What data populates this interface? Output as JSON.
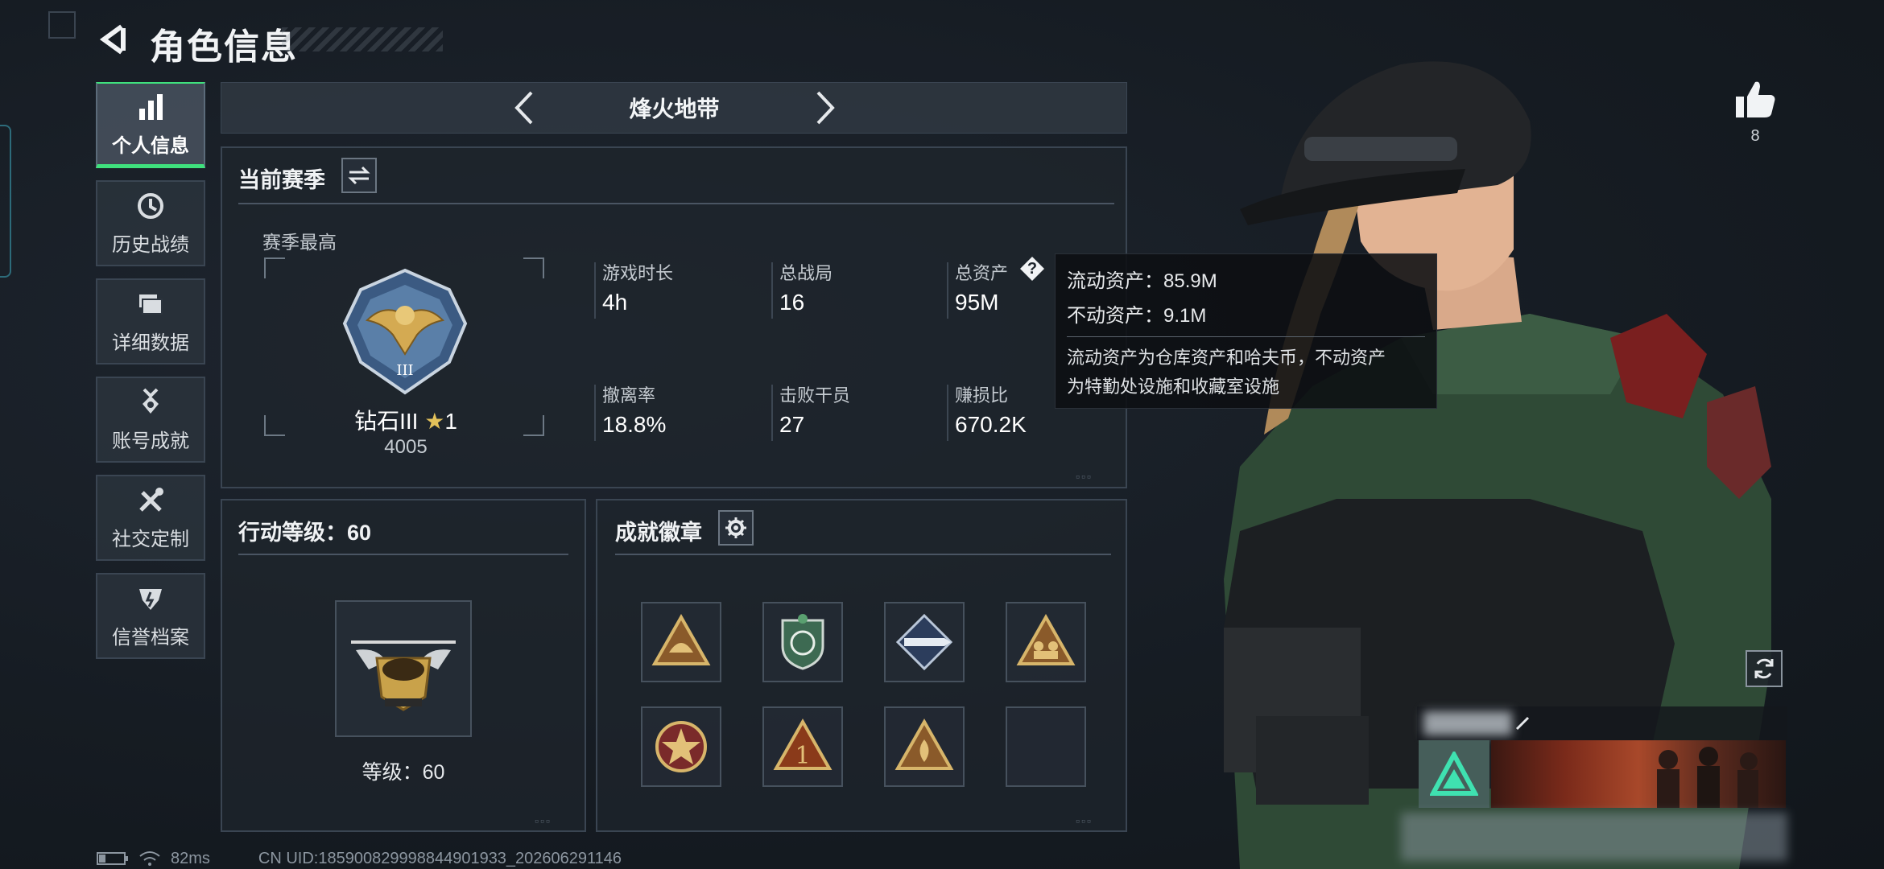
{
  "header": {
    "title": "角色信息"
  },
  "sidebar": {
    "items": [
      {
        "label": "个人信息",
        "icon": "bar-chart-icon",
        "active": true
      },
      {
        "label": "历史战绩",
        "icon": "clock-history-icon",
        "active": false
      },
      {
        "label": "详细数据",
        "icon": "folder-icon",
        "active": false
      },
      {
        "label": "账号成就",
        "icon": "medal-icon",
        "active": false
      },
      {
        "label": "社交定制",
        "icon": "tools-icon",
        "active": false
      },
      {
        "label": "信誉档案",
        "icon": "shield-credit-icon",
        "active": false
      }
    ]
  },
  "mode": {
    "name": "烽火地带"
  },
  "season": {
    "title": "当前赛季",
    "best_label": "赛季最高",
    "rank_name": "钻石III",
    "rank_stars": "1",
    "rank_points": "4005",
    "stats": [
      {
        "label": "游戏时长",
        "value": "4h"
      },
      {
        "label": "总战局",
        "value": "16"
      },
      {
        "label": "总资产",
        "value": "95M"
      },
      {
        "label": "撤离率",
        "value": "18.8%"
      },
      {
        "label": "击败干员",
        "value": "27"
      },
      {
        "label": "赚损比",
        "value": "670.2K"
      }
    ],
    "help_glyph": "?"
  },
  "tooltip": {
    "liquid": "流动资产：85.9M",
    "fixed": "不动资产：9.1M",
    "desc_line1": "流动资产为仓库资产和哈夫币，不动资产",
    "desc_line2": "为特勤处设施和收藏室设施"
  },
  "action_level": {
    "title": "行动等级：60",
    "level_text": "等级：60"
  },
  "achievements": {
    "title": "成就徽章",
    "badges": [
      "triangle-badge",
      "green-shield-badge",
      "rocket-badge",
      "triangle-group-badge",
      "star-circle-badge",
      "triangle-one-badge",
      "triangle-flame-badge",
      "empty-slot"
    ]
  },
  "likes": {
    "count": "8"
  },
  "status": {
    "ping": "82ms",
    "uid": "CN UID:185900829998844901933_202606291146"
  },
  "colors": {
    "accent_green": "#3fe17d",
    "panel_border": "#3a4552",
    "gold": "#c9a24a"
  }
}
